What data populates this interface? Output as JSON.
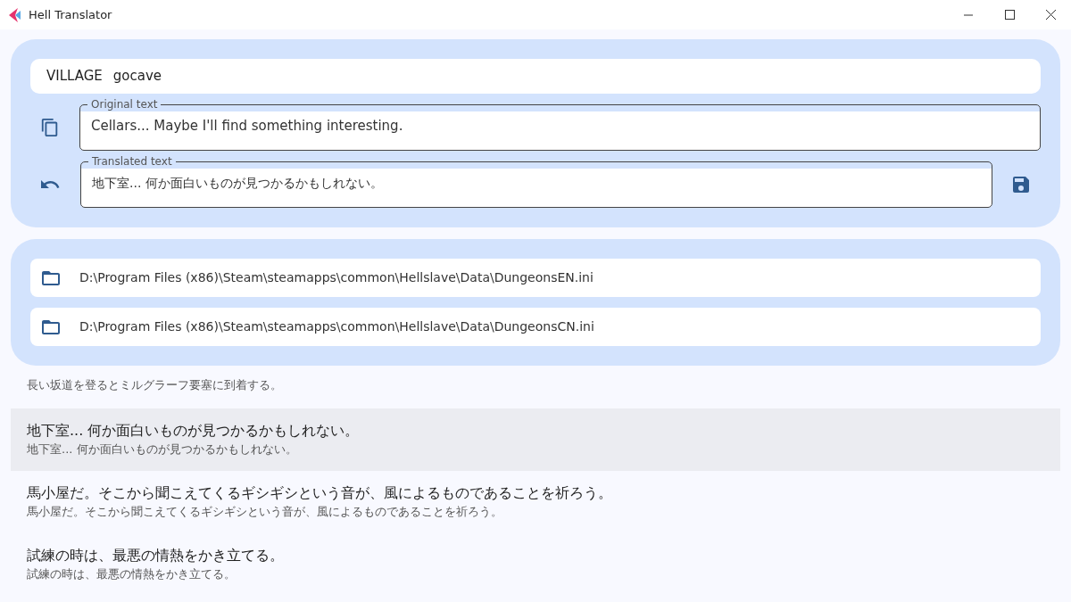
{
  "window": {
    "title": "Hell Translator"
  },
  "entry": {
    "section": "VILLAGE",
    "key": "gocave",
    "original": {
      "label": "Original text",
      "value": "Cellars... Maybe I'll find something interesting."
    },
    "translated": {
      "label": "Translated text",
      "value": "地下室... 何か面白いものが見つかるかもしれない。"
    }
  },
  "files": [
    {
      "path": "D:\\Program Files (x86)\\Steam\\steamapps\\common\\Hellslave\\Data\\DungeonsEN.ini"
    },
    {
      "path": "D:\\Program Files (x86)\\Steam\\steamapps\\common\\Hellslave\\Data\\DungeonsCN.ini"
    }
  ],
  "lines": [
    {
      "secondary": "長い坂道を登るとミルグラーフ要塞に到着する。",
      "selected": false
    },
    {
      "primary": "地下室... 何か面白いものが見つかるかもしれない。",
      "secondary": "地下室... 何か面白いものが見つかるかもしれない。",
      "selected": true
    },
    {
      "primary": "馬小屋だ。そこから聞こえてくるギシギシという音が、風によるものであることを祈ろう。",
      "secondary": "馬小屋だ。そこから聞こえてくるギシギシという音が、風によるものであることを祈ろう。",
      "selected": false
    },
    {
      "primary": "試練の時は、最悪の情熱をかき立てる。",
      "secondary": "試練の時は、最悪の情熱をかき立てる。",
      "selected": false
    }
  ]
}
